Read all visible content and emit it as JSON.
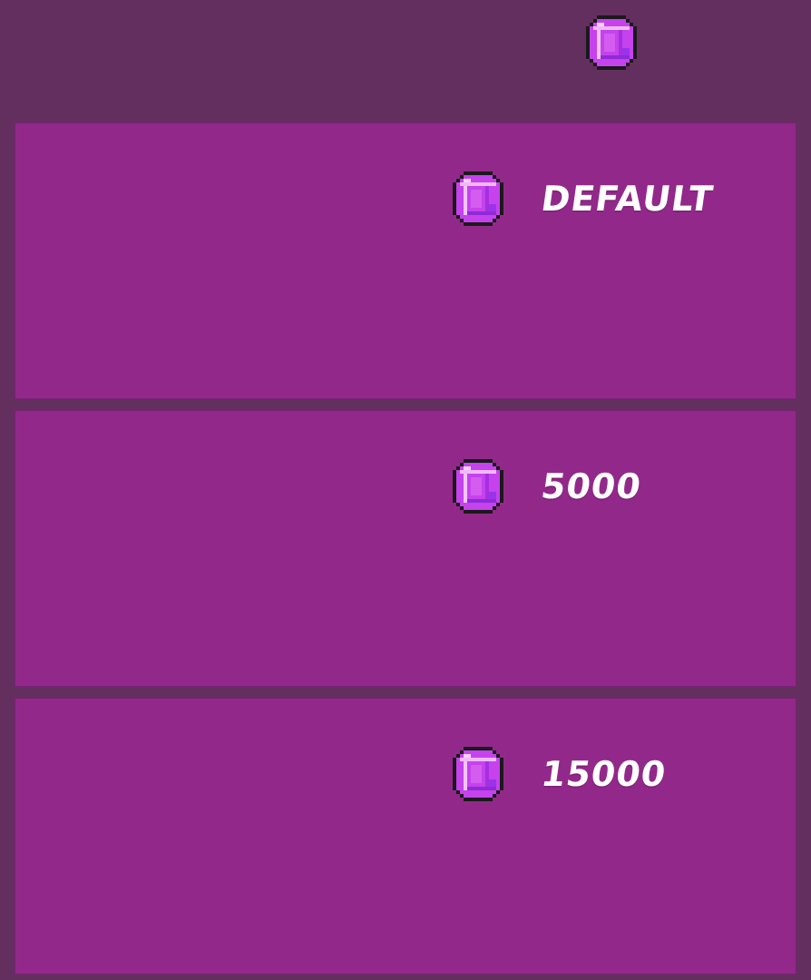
{
  "header": {
    "currency_icon": "purple-gem-icon"
  },
  "shop": {
    "items": [
      {
        "price": "DEFAULT",
        "icon": "purple-gem-icon"
      },
      {
        "price": "5000",
        "icon": "purple-gem-icon"
      },
      {
        "price": "15000",
        "icon": "purple-gem-icon"
      }
    ]
  },
  "colors": {
    "background": "#632f5f",
    "panel": "#92298a",
    "text": "#ffffff",
    "gem": "#d24bf0"
  }
}
